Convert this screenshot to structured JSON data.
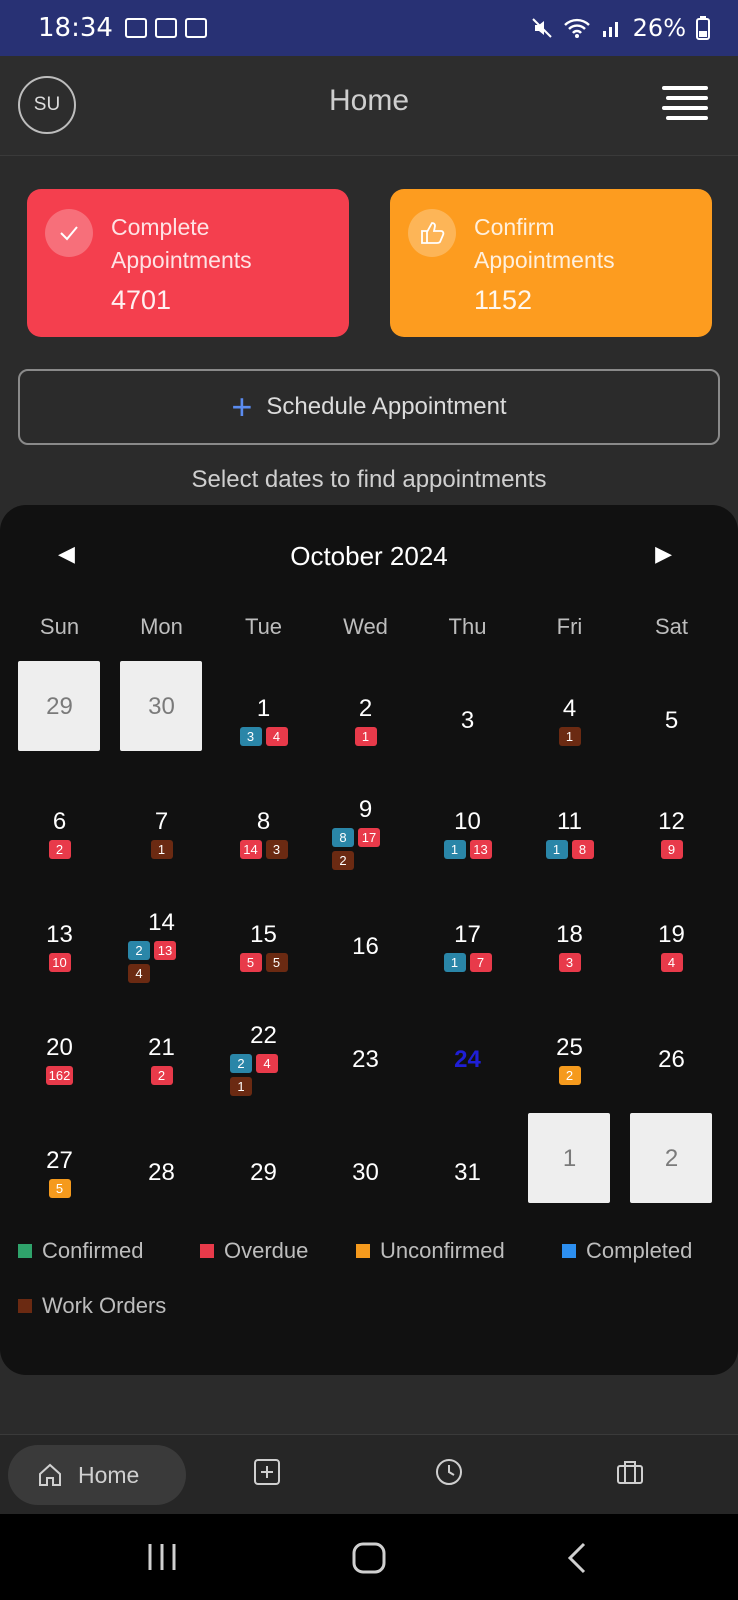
{
  "status_bar": {
    "time": "18:34",
    "battery": "26%"
  },
  "header": {
    "avatar": "SU",
    "title": "Home"
  },
  "cards": [
    {
      "label_line1": "Complete",
      "label_line2": "Appointments",
      "count": "4701",
      "color": "#f43f4e"
    },
    {
      "label_line1": "Confirm",
      "label_line2": "Appointments",
      "count": "1152",
      "color": "#fd9c1f"
    }
  ],
  "schedule_button": {
    "label": "Schedule Appointment"
  },
  "hint": "Select dates to find appointments",
  "calendar": {
    "month": "October 2024",
    "weekdays": [
      "Sun",
      "Mon",
      "Tue",
      "Wed",
      "Thu",
      "Fri",
      "Sat"
    ],
    "rows": [
      [
        {
          "d": "29",
          "muted": true,
          "b": []
        },
        {
          "d": "30",
          "muted": true,
          "b": []
        },
        {
          "d": "1",
          "b": [
            [
              "c",
              "3"
            ],
            [
              "o",
              "4"
            ]
          ]
        },
        {
          "d": "2",
          "b": [
            [
              "o",
              "1"
            ]
          ]
        },
        {
          "d": "3",
          "b": []
        },
        {
          "d": "4",
          "b": [
            [
              "w",
              "1"
            ]
          ]
        },
        {
          "d": "5",
          "b": []
        }
      ],
      [
        {
          "d": "6",
          "b": [
            [
              "o",
              "2"
            ]
          ]
        },
        {
          "d": "7",
          "b": [
            [
              "w",
              "1"
            ]
          ]
        },
        {
          "d": "8",
          "b": [
            [
              "o",
              "14"
            ],
            [
              "w",
              "3"
            ]
          ]
        },
        {
          "d": "9",
          "b": [
            [
              "c",
              "8"
            ],
            [
              "o",
              "17"
            ],
            [
              "w",
              "2"
            ]
          ]
        },
        {
          "d": "10",
          "b": [
            [
              "c",
              "1"
            ],
            [
              "o",
              "13"
            ]
          ]
        },
        {
          "d": "11",
          "b": [
            [
              "c",
              "1"
            ],
            [
              "o",
              "8"
            ]
          ]
        },
        {
          "d": "12",
          "b": [
            [
              "o",
              "9"
            ]
          ]
        }
      ],
      [
        {
          "d": "13",
          "b": [
            [
              "o",
              "10"
            ]
          ]
        },
        {
          "d": "14",
          "b": [
            [
              "c",
              "2"
            ],
            [
              "o",
              "13"
            ],
            [
              "w",
              "4"
            ]
          ]
        },
        {
          "d": "15",
          "b": [
            [
              "o",
              "5"
            ],
            [
              "w",
              "5"
            ]
          ]
        },
        {
          "d": "16",
          "b": []
        },
        {
          "d": "17",
          "b": [
            [
              "c",
              "1"
            ],
            [
              "o",
              "7"
            ]
          ]
        },
        {
          "d": "18",
          "b": [
            [
              "o",
              "3"
            ]
          ]
        },
        {
          "d": "19",
          "b": [
            [
              "o",
              "4"
            ]
          ]
        }
      ],
      [
        {
          "d": "20",
          "b": [
            [
              "o",
              "162"
            ]
          ]
        },
        {
          "d": "21",
          "b": [
            [
              "o",
              "2"
            ]
          ]
        },
        {
          "d": "22",
          "b": [
            [
              "c",
              "2"
            ],
            [
              "o",
              "4"
            ],
            [
              "w",
              "1"
            ]
          ]
        },
        {
          "d": "23",
          "b": []
        },
        {
          "d": "24",
          "today": true,
          "b": []
        },
        {
          "d": "25",
          "b": [
            [
              "u",
              "2"
            ]
          ]
        },
        {
          "d": "26",
          "b": []
        }
      ],
      [
        {
          "d": "27",
          "b": [
            [
              "u",
              "5"
            ]
          ]
        },
        {
          "d": "28",
          "b": []
        },
        {
          "d": "29",
          "b": []
        },
        {
          "d": "30",
          "b": []
        },
        {
          "d": "31",
          "b": []
        },
        {
          "d": "1",
          "muted": true,
          "b": []
        },
        {
          "d": "2",
          "muted": true,
          "b": []
        }
      ]
    ]
  },
  "legend": [
    {
      "label": "Confirmed",
      "color": "#2fa36b"
    },
    {
      "label": "Overdue",
      "color": "#e83a4a"
    },
    {
      "label": "Unconfirmed",
      "color": "#f59a1d"
    },
    {
      "label": "Completed",
      "color": "#2d8ff0"
    },
    {
      "label": "Work Orders",
      "color": "#6b2a12"
    }
  ],
  "bottom_nav": {
    "home_label": "Home"
  }
}
